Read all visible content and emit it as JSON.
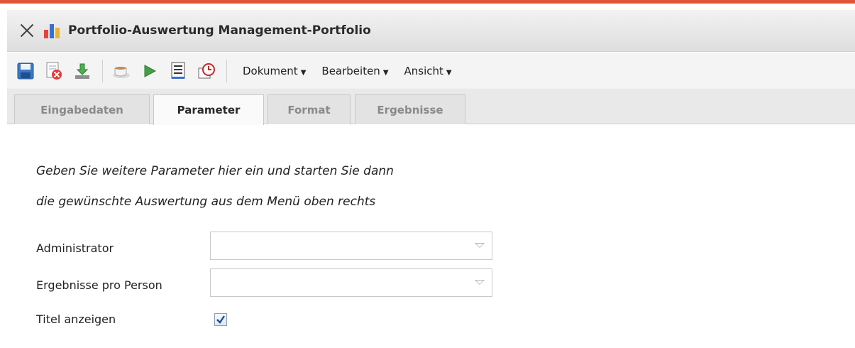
{
  "window": {
    "title": "Portfolio-Auswertung Management-Portfolio",
    "accent_color": "#e0553a"
  },
  "toolbar": {
    "icons": [
      "save-icon",
      "delete-document-icon",
      "download-icon",
      "coffee-cup-icon",
      "play-arrow-icon",
      "list-document-icon",
      "schedule-icon"
    ],
    "menus": [
      {
        "label": "Dokument"
      },
      {
        "label": "Bearbeiten"
      },
      {
        "label": "Ansicht"
      }
    ]
  },
  "tabs": [
    {
      "label": "Eingabedaten",
      "active": false
    },
    {
      "label": "Parameter",
      "active": true
    },
    {
      "label": "Format",
      "active": false
    },
    {
      "label": "Ergebnisse",
      "active": false
    }
  ],
  "form": {
    "intro_line1": "Geben Sie weitere Parameter hier ein und starten Sie dann",
    "intro_line2": "die gewünschte Auswertung aus dem Menü oben rechts",
    "administrator": {
      "label": "Administrator",
      "value": ""
    },
    "results_per_person": {
      "label": "Ergebnisse pro Person",
      "value": ""
    },
    "show_title": {
      "label": "Titel anzeigen",
      "checked": true
    }
  }
}
